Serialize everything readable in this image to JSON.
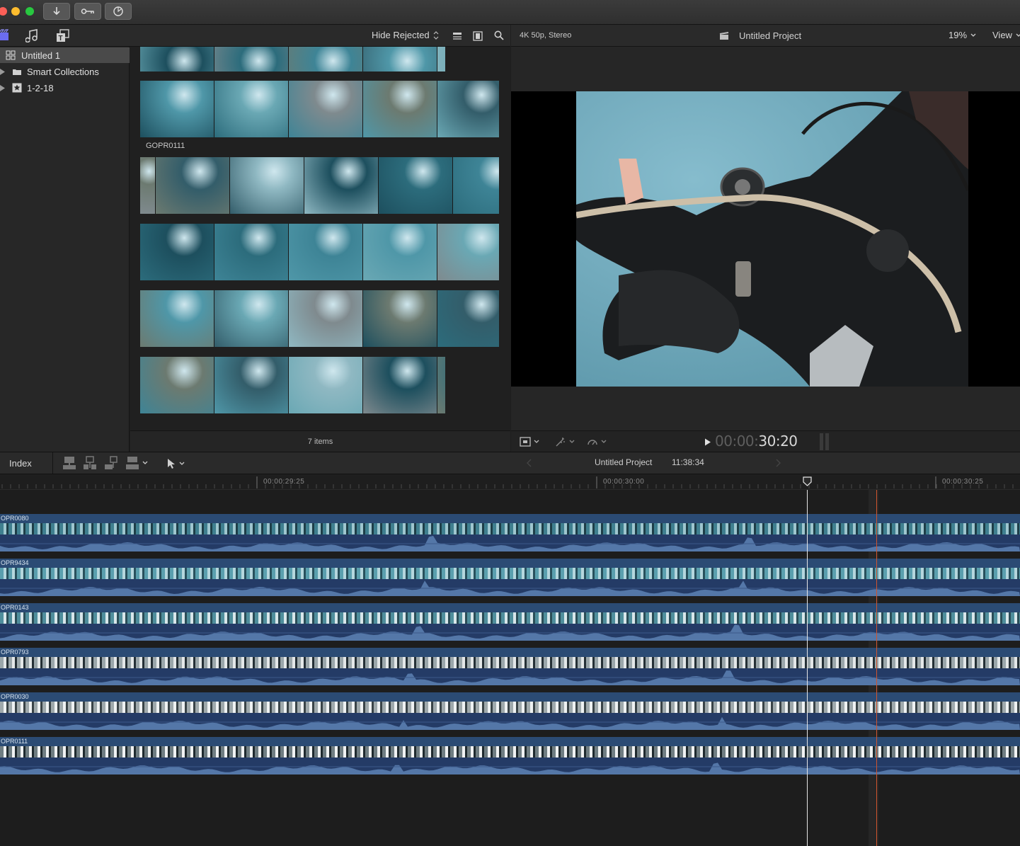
{
  "window": {
    "traffic_lights": {
      "close": "#fc5f57",
      "minimize": "#fdbc2e",
      "zoom": "#28c840"
    },
    "toolbar_icons": [
      "import-icon",
      "key-icon",
      "background-tasks-icon"
    ]
  },
  "library_toolbar": {
    "icons": [
      "libraries-icon",
      "photos-audio-icon",
      "titles-generators-icon"
    ]
  },
  "browser_toolbar": {
    "filter_label": "Hide Rejected",
    "icons": [
      "list-view-icon",
      "filmstrip-view-icon",
      "search-icon"
    ]
  },
  "viewer_toolbar": {
    "format": "4K 50p, Stereo",
    "project_title": "Untitled Project",
    "zoom": "19%",
    "view_label": "View"
  },
  "sidebar": {
    "items": [
      {
        "label": "Untitled 1",
        "selected": true,
        "icon": "library-grid-icon"
      },
      {
        "label": "Smart Collections",
        "selected": false,
        "icon": "folder-icon"
      },
      {
        "label": "1-2-18",
        "selected": false,
        "icon": "event-star-icon"
      }
    ]
  },
  "browser": {
    "clip_label": "GOPR0111",
    "item_count": "7 items"
  },
  "viewer_controls": {
    "timecode_dim": "00:00:",
    "timecode_bright": "30:20"
  },
  "timeline_toolbar": {
    "index_label": "Index",
    "project_name": "Untitled Project",
    "duration": "11:38:34"
  },
  "ruler": {
    "ticks": [
      "00:00:29:25",
      "00:00:30:00",
      "00:00:30:25"
    ]
  },
  "tracks": [
    {
      "label": "OPR0080"
    },
    {
      "label": "OPR9434"
    },
    {
      "label": "OPR0143"
    },
    {
      "label": "OPR0793"
    },
    {
      "label": "OPR0030"
    },
    {
      "label": "OPR0111"
    }
  ]
}
